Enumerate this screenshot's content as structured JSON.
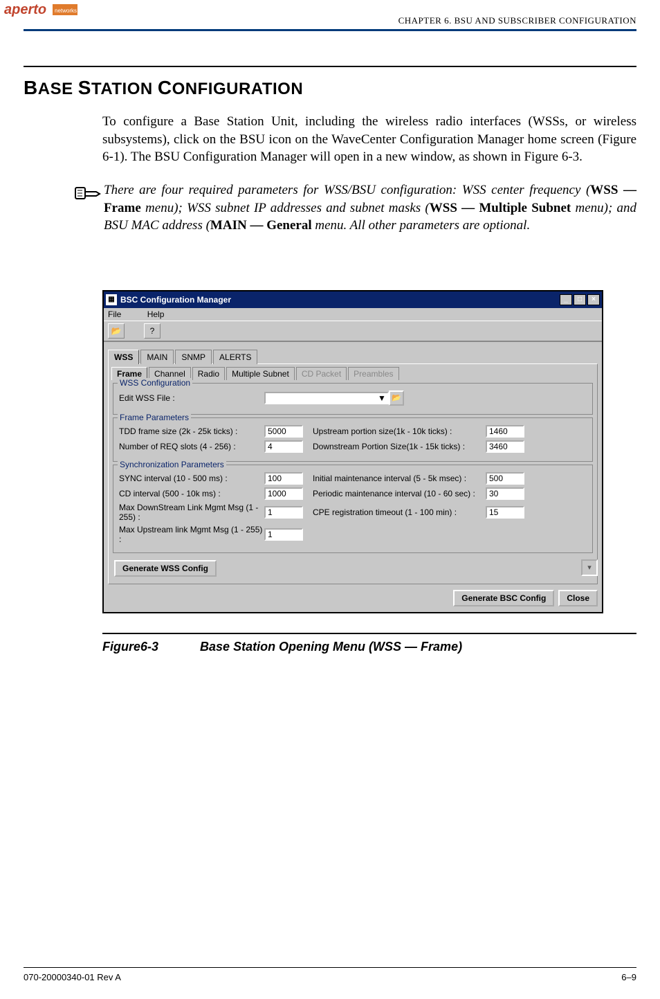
{
  "header": {
    "chapter_line": "CHAPTER 6.  BSU AND SUBSCRIBER CONFIGURATION",
    "logo_text": "aperto",
    "logo_sub": "networks"
  },
  "section": {
    "title_html": "BASE STATION CONFIGURATION"
  },
  "body": {
    "para": "To configure a Base Station Unit, including the wireless radio interfaces (WSSs, or wireless subsystems), click on the BSU icon on the WaveCenter Configuration Manager home screen (Figure 6-1). The BSU Configuration Manager will open in a new window, as shown in Figure 6-3."
  },
  "note": {
    "pre": "There are four required parameters for WSS/BSU configuration: WSS center frequency (",
    "b1": "WSS — Frame",
    "mid1": " menu); WSS subnet IP addresses and subnet masks (",
    "b2": "WSS — Multiple Subnet",
    "mid2": " menu); and BSU MAC address (",
    "b3": "MAIN — General",
    "post": " menu. All other parameters are optional."
  },
  "window": {
    "title": "BSC Configuration Manager",
    "menu": {
      "file": "File",
      "help": "Help"
    },
    "main_tabs": [
      "WSS",
      "MAIN",
      "SNMP",
      "ALERTS"
    ],
    "sub_tabs": [
      "Frame",
      "Channel",
      "Radio",
      "Multiple Subnet",
      "CD Packet",
      "Preambles"
    ],
    "groups": {
      "wss_config": {
        "legend": "WSS Configuration",
        "edit_label": "Edit WSS File :",
        "edit_value": ""
      },
      "frame_params": {
        "legend": "Frame Parameters",
        "r1l": "TDD frame size (2k - 25k ticks) :",
        "r1v": "5000",
        "r1r": "Upstream portion size(1k - 10k ticks) :",
        "r1rv": "1460",
        "r2l": "Number of REQ slots (4 - 256) :",
        "r2v": "4",
        "r2r": "Downstream Portion Size(1k - 15k ticks) :",
        "r2rv": "3460"
      },
      "sync_params": {
        "legend": "Synchronization Parameters",
        "s1l": "SYNC interval (10 - 500 ms) :",
        "s1v": "100",
        "s1r": "Initial maintenance interval (5 - 5k msec) :",
        "s1rv": "500",
        "s2l": "CD interval (500 - 10k ms) :",
        "s2v": "1000",
        "s2r": "Periodic maintenance interval (10 - 60 sec) :",
        "s2rv": "30",
        "s3l": "Max DownStream Link Mgmt Msg (1 - 255) :",
        "s3v": "1",
        "s3r": "CPE registration timeout (1 - 100 min) :",
        "s3rv": "15",
        "s4l": "Max Upstream link Mgmt Msg (1 - 255) :",
        "s4v": "1"
      }
    },
    "buttons": {
      "gen_wss": "Generate WSS Config",
      "gen_bsc": "Generate BSC Config",
      "close": "Close"
    }
  },
  "figure": {
    "num": "Figure6-3",
    "caption": "Base Station Opening Menu (WSS — Frame)"
  },
  "footer": {
    "left": "070-20000340-01 Rev A",
    "right": "6–9"
  }
}
